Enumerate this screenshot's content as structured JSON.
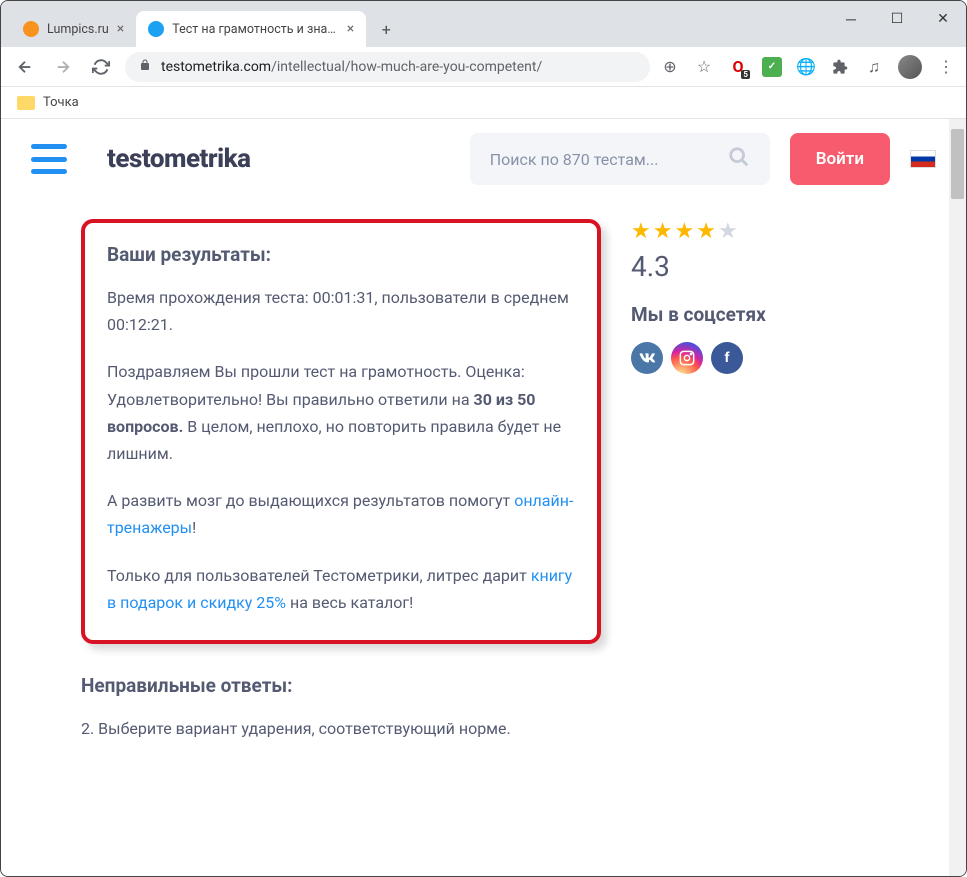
{
  "window": {
    "tabs": [
      {
        "title": "Lumpics.ru",
        "favicon_color": "#f7931e",
        "active": false
      },
      {
        "title": "Тест на грамотность и знание р",
        "favicon_color": "#1da1f2",
        "active": true
      }
    ],
    "url_domain": "testometrika.com",
    "url_path": "/intellectual/how-much-are-you-competent/",
    "bookmark": "Точка"
  },
  "header": {
    "logo": "testometrika",
    "search_placeholder": "Поиск по 870 тестам...",
    "login_label": "Войти"
  },
  "results": {
    "title": "Ваши результаты:",
    "time_line": "Время прохождения теста: 00:01:31, пользователи в среднем 00:12:21.",
    "congrats_before": "Поздравляем Вы прошли тест на грамотность. Оценка: Удовлетворительно! Вы правильно ответили на ",
    "score": "30 из 50 вопросов.",
    "congrats_after": " В целом, неплохо, но повторить правила будет не лишним.",
    "brain_before": "А развить мозг до выдающихся результатов помогут ",
    "brain_link": "онлайн-тренажеры",
    "litres_before": "Только для пользователей Тестометрики, литрес дарит ",
    "litres_link": "книгу в подарок и скидку 25%",
    "litres_after": " на весь каталог!"
  },
  "wrong": {
    "title": "Неправильные ответы:",
    "q2": "2. Выберите вариант ударения, соответствующий норме."
  },
  "sidebar": {
    "rating": "4.3",
    "stars_filled": 4,
    "social_title": "Мы в соцсетях",
    "vk": "VK",
    "fb": "f"
  }
}
